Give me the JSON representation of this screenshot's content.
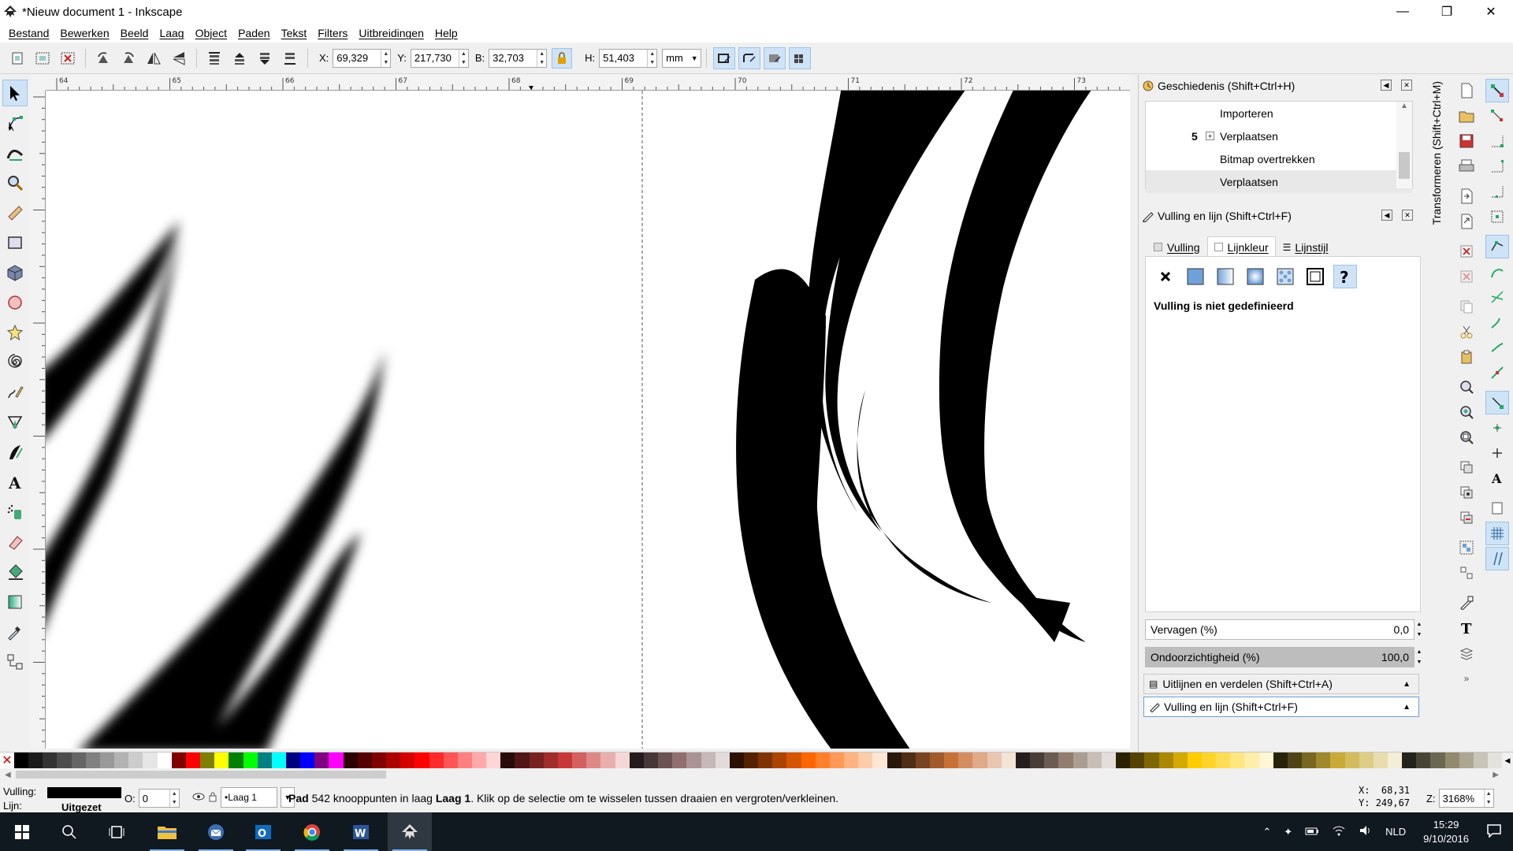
{
  "window": {
    "title": "*Nieuw document 1 - Inkscape",
    "controls": [
      "—",
      "❐",
      "✕"
    ]
  },
  "menu": [
    "Bestand",
    "Bewerken",
    "Beeld",
    "Laag",
    "Object",
    "Paden",
    "Tekst",
    "Filters",
    "Uitbreidingen",
    "Help"
  ],
  "toolbar": {
    "x_label": "X:",
    "x_value": "69,329",
    "y_label": "Y:",
    "y_value": "217,730",
    "w_label": "B:",
    "w_value": "32,703",
    "h_label": "H:",
    "h_value": "51,403",
    "unit": "mm"
  },
  "ruler_top_labels": [
    "64",
    "65",
    "66",
    "67",
    "68",
    "69",
    "70",
    "71",
    "72",
    "73"
  ],
  "dock": {
    "history": {
      "title": "Geschiedenis (Shift+Ctrl+H)",
      "items": [
        {
          "label": "Importeren",
          "count": ""
        },
        {
          "label": "Verplaatsen",
          "count": "5"
        },
        {
          "label": "Bitmap overtrekken",
          "count": ""
        },
        {
          "label": "Verplaatsen",
          "count": ""
        }
      ]
    },
    "fill_stroke": {
      "title": "Vulling en lijn (Shift+Ctrl+F)",
      "tabs": [
        "Vulling",
        "Lijnkleur",
        "Lijnstijl"
      ],
      "active_tab": "Lijnkleur",
      "status": "Vulling is niet gedefinieerd",
      "blur_label": "Vervagen (%)",
      "blur_value": "0,0",
      "opacity_label": "Ondoorzichtigheid (%)",
      "opacity_value": "100,0",
      "opacity_percent": 100
    },
    "align_panel": "Uitlijnen en verdelen (Shift+Ctrl+A)",
    "fill_panel_collapsed": "Vulling en lijn (Shift+Ctrl+F)",
    "transform_tab": "Transformeren (Shift+Ctrl+M)"
  },
  "statusbar": {
    "fill_label": "Vulling:",
    "stroke_label": "Lijn:",
    "stroke_value": "Uitgezet",
    "opacity_label": "O:",
    "opacity_value": "0",
    "layer": "•Laag 1",
    "message_bold": "Pad",
    "message_mid": " 542 knooppunten in laag ",
    "message_layer": "Laag 1",
    "message_rest": ". Klik op de selectie om te wisselen tussen draaien en vergroten/verkleinen.",
    "cursor_x_label": "X:",
    "cursor_x": "68,31",
    "cursor_y_label": "Y:",
    "cursor_y": "249,67",
    "zoom_label": "Z:",
    "zoom_value": "3168%"
  },
  "palette": [
    "#000000",
    "#1a1a1a",
    "#333333",
    "#4d4d4d",
    "#666666",
    "#808080",
    "#999999",
    "#b3b3b3",
    "#cccccc",
    "#e6e6e6",
    "#ffffff",
    "#800000",
    "#ff0000",
    "#808000",
    "#ffff00",
    "#008000",
    "#00ff00",
    "#008080",
    "#00ffff",
    "#000080",
    "#0000ff",
    "#800080",
    "#ff00ff",
    "#2b0000",
    "#550000",
    "#800000",
    "#aa0000",
    "#d40000",
    "#ff0000",
    "#ff2a2a",
    "#ff5555",
    "#ff8080",
    "#ffaaaa",
    "#ffd5d5",
    "#280b0b",
    "#501616",
    "#782121",
    "#a02c2c",
    "#c83737",
    "#d35f5f",
    "#de8787",
    "#e9afaf",
    "#f4d7d7",
    "#241c1c",
    "#483737",
    "#6c5353",
    "#916f6f",
    "#ac9393",
    "#c8b7b7",
    "#e3dbdb",
    "#2b1100",
    "#552200",
    "#803300",
    "#aa4400",
    "#d45500",
    "#ff6600",
    "#ff7f2a",
    "#ff9955",
    "#ffb380",
    "#ffccaa",
    "#ffe6d5",
    "#28170b",
    "#502d16",
    "#784421",
    "#a05a2c",
    "#c87137",
    "#d38d5f",
    "#deaa87",
    "#e9c6af",
    "#f4e3d7",
    "#241f1c",
    "#483e37",
    "#6c5d53",
    "#917c6f",
    "#ac9d93",
    "#c8beb7",
    "#e3dedb",
    "#2b2200",
    "#554400",
    "#806600",
    "#aa8800",
    "#d4aa00",
    "#ffcc00",
    "#ffd42a",
    "#ffdd55",
    "#ffe680",
    "#ffeeaa",
    "#fff6d5",
    "#28220b",
    "#504416",
    "#786721",
    "#a0892c",
    "#c8ab37",
    "#d3bc5f",
    "#decd87",
    "#e9ddaf",
    "#f4eed7",
    "#24221c",
    "#484537",
    "#6c6753",
    "#918a6f",
    "#aca793",
    "#c8c4b7",
    "#e3e2db"
  ],
  "taskbar": {
    "time": "15:29",
    "date": "9/10/2016",
    "language": "NLD"
  }
}
